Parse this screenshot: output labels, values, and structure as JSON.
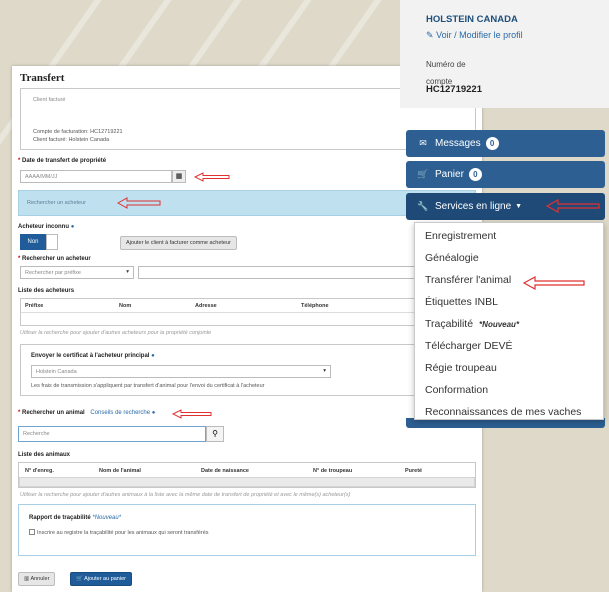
{
  "profile": {
    "name": "HOLSTEIN CANADA",
    "edit_link": "Voir / Modifier le profil",
    "account_label": "Numéro de compte",
    "account_number": "HC12719221"
  },
  "nav": {
    "messages": {
      "label": "Messages",
      "count": "0"
    },
    "cart": {
      "label": "Panier",
      "count": "0"
    },
    "services": {
      "label": "Services en ligne"
    }
  },
  "services_menu": [
    {
      "label": "Enregistrement",
      "tag": ""
    },
    {
      "label": "Généalogie",
      "tag": ""
    },
    {
      "label": "Transférer l'animal",
      "tag": ""
    },
    {
      "label": "Étiquettes INBL",
      "tag": ""
    },
    {
      "label": "Traçabilité",
      "tag": "*Nouveau*"
    },
    {
      "label": "Télécharger DEVÉ",
      "tag": ""
    },
    {
      "label": "Régie troupeau",
      "tag": ""
    },
    {
      "label": "Conformation",
      "tag": ""
    },
    {
      "label": "Reconnaissances de mes vaches",
      "tag": ""
    }
  ],
  "transfer": {
    "title": "Transfert",
    "billed_client_label": "Client facturé",
    "billing_account": "Compte de facturation: HC12719221",
    "billed_client": "Client facturé: Holstein Canada",
    "transfer_date_label": "Date de transfert de propriété",
    "date_placeholder": "AAAA/MM/JJ",
    "buyer_search_bar": "Rechercher un acheteur",
    "unknown_buyer_label": "Acheteur inconnu",
    "no_toggle": "Non",
    "add_billed_client_button": "Ajouter le client à facturer comme acheteur",
    "search_buyer_label": "Rechercher un acheteur",
    "search_by_prefix": "Rechercher par préfixe",
    "buyers_list_label": "Liste des acheteurs",
    "buyers_columns": [
      "Préfixe",
      "Nom",
      "Adresse",
      "Téléphone"
    ],
    "buyers_note": "Utiliser la recherche pour ajouter d'autres acheteurs pour la propriété conjointe",
    "send_certificate_label": "Envoyer le certificat à l'acheteur principal",
    "certificate_recipient": "Holstein Canada",
    "transmission_note": "Les frais de transmission s'appliquent par transfert d'animal pour l'envoi du certificat à l'acheteur",
    "search_animal_label": "Rechercher un animal",
    "animal_search_hint": "Conseils de recherche",
    "animal_search_placeholder": "Recherche",
    "animals_list_label": "Liste des animaux",
    "animals_columns": [
      "N° d'enreg.",
      "Nom de l'animal",
      "Date de naissance",
      "N° de troupeau",
      "Pureté"
    ],
    "animals_note": "Utiliser la recherche pour ajouter d'autres animaux à la liste avec la même date de transfert de propriété et avec le même(s) acheteur(s)",
    "traceability_title": "Rapport de traçabilité",
    "traceability_tag": "*Nouveau*",
    "traceability_checkbox": "Inscrire au registre la traçabilité pour les animaux qui seront transférés",
    "cancel_button": "Annuler",
    "add_to_cart_button": "Ajouter au panier"
  },
  "colors": {
    "nav_blue": "#2d5f93",
    "annotation_red": "#e03030",
    "page_bg": "#ded9c8"
  }
}
